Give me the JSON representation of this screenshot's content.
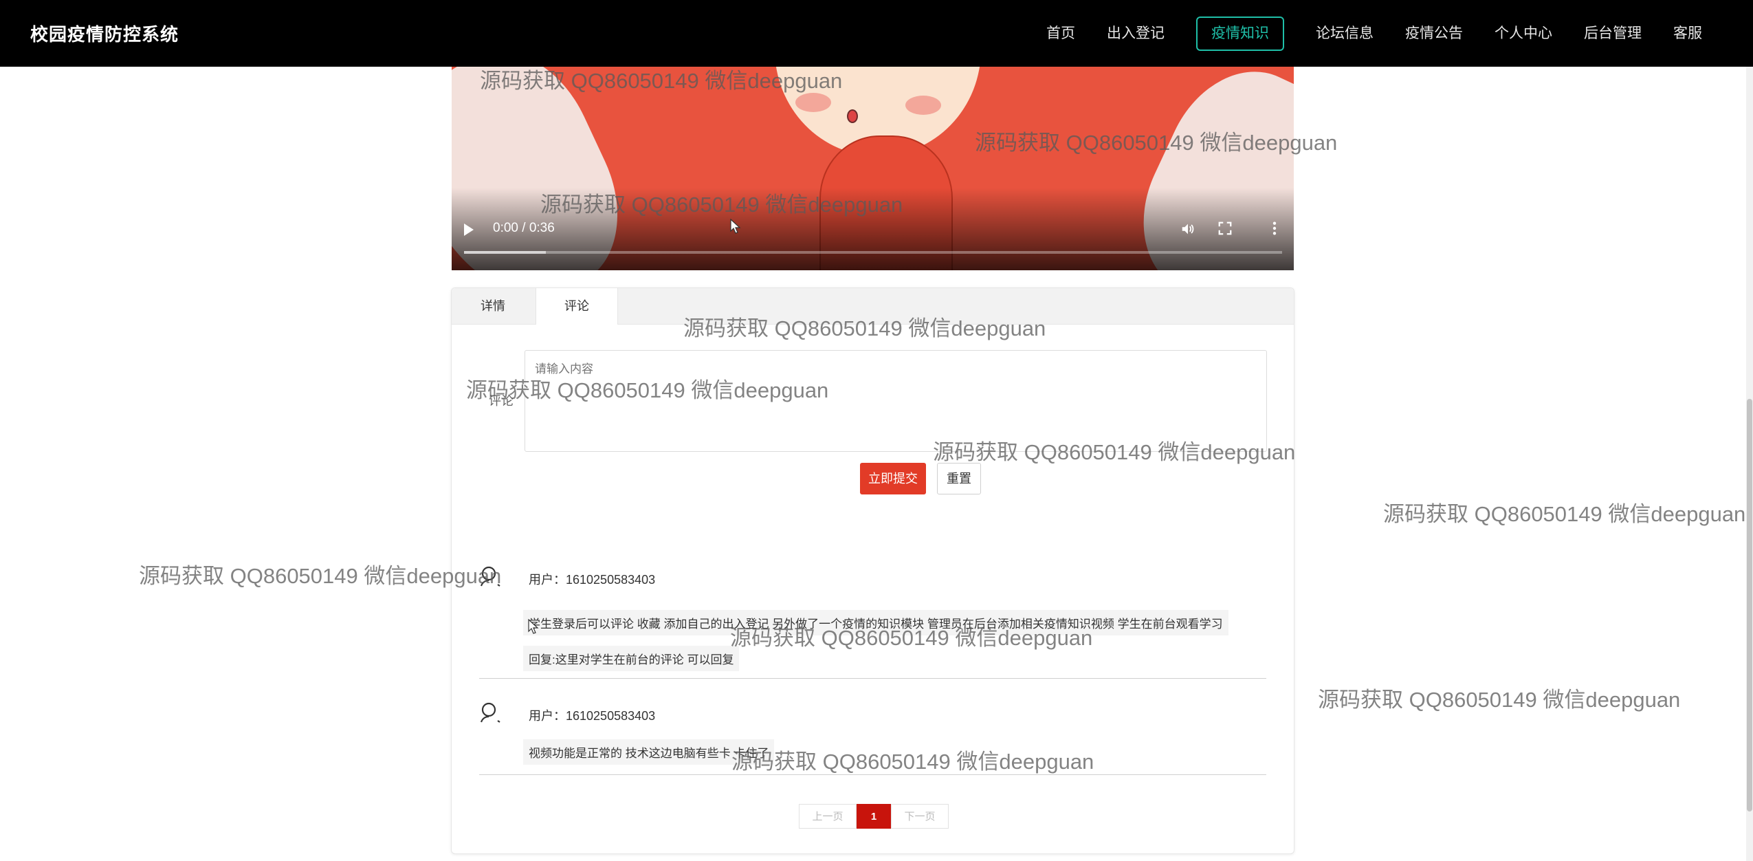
{
  "app": {
    "title": "校园疫情防控系统"
  },
  "nav": {
    "items": [
      {
        "label": "首页",
        "active": false
      },
      {
        "label": "出入登记",
        "active": false
      },
      {
        "label": "疫情知识",
        "active": true
      },
      {
        "label": "论坛信息",
        "active": false
      },
      {
        "label": "疫情公告",
        "active": false
      },
      {
        "label": "个人中心",
        "active": false
      },
      {
        "label": "后台管理",
        "active": false
      },
      {
        "label": "客服",
        "active": false
      }
    ]
  },
  "video": {
    "time": "0:00 / 0:36",
    "icons": [
      "play-icon",
      "volume-icon",
      "fullscreen-icon",
      "more-options-icon"
    ]
  },
  "tabs": [
    {
      "label": "详情",
      "active": false
    },
    {
      "label": "评论",
      "active": true
    }
  ],
  "comment_form": {
    "label": "评论",
    "placeholder": "请输入内容",
    "submit_label": "立即提交",
    "reset_label": "重置"
  },
  "comments": [
    {
      "user": "用户：1610250583403",
      "content": "学生登录后可以评论 收藏 添加自己的出入登记 另外做了一个疫情的知识模块 管理员在后台添加相关疫情知识视频 学生在前台观看学习",
      "reply": "回复:这里对学生在前台的评论 可以回复"
    },
    {
      "user": "用户：1610250583403",
      "content": "视频功能是正常的 技术这边电脑有些卡 卡住了"
    }
  ],
  "pagination": {
    "prev": "上一页",
    "current": "1",
    "next": "下一页"
  },
  "watermark": {
    "text": "源码获取 QQ86050149 微信deepguan"
  },
  "colors": {
    "accent": "#1fbfa8",
    "primary_button": "#e23b27",
    "current_page": "#c8140c",
    "topbar": "#000000"
  }
}
